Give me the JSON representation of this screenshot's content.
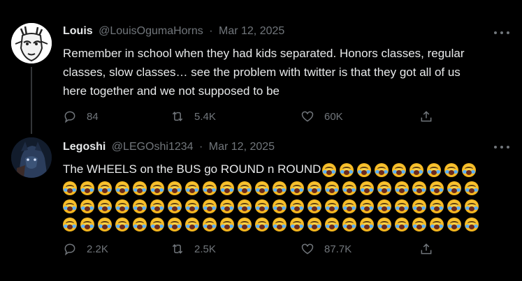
{
  "tweets": [
    {
      "name": "Louis",
      "handle": "@LouisOgumaHorns",
      "separator": "·",
      "date": "Mar 12, 2025",
      "text_lines": [
        "Remember in school when they had kids separated. Honors classes, regular",
        "classes, slow classes… see the problem with twitter is that they got all of us",
        "here together and we not supposed to be"
      ],
      "stats": {
        "replies": "84",
        "reposts": "5.4K",
        "likes": "60K"
      }
    },
    {
      "name": "Legoshi",
      "handle": "@LEGOshi1234",
      "separator": "·",
      "date": "Mar 12, 2025",
      "text": "The WHEELS on the BUS go ROUND n ROUND",
      "emoji": "crying-face",
      "emoji_rows": [
        9,
        24,
        24,
        24
      ],
      "stats": {
        "replies": "2.2K",
        "reposts": "2.5K",
        "likes": "87.7K"
      }
    }
  ],
  "icons": {
    "reply": "comment-icon",
    "repost": "repost-icon",
    "like": "heart-icon",
    "share": "share-icon",
    "more": "more-dots-icon"
  },
  "colors": {
    "background": "#000000",
    "text": "#e7e9ea",
    "muted": "#71767b",
    "divider": "#333639"
  }
}
